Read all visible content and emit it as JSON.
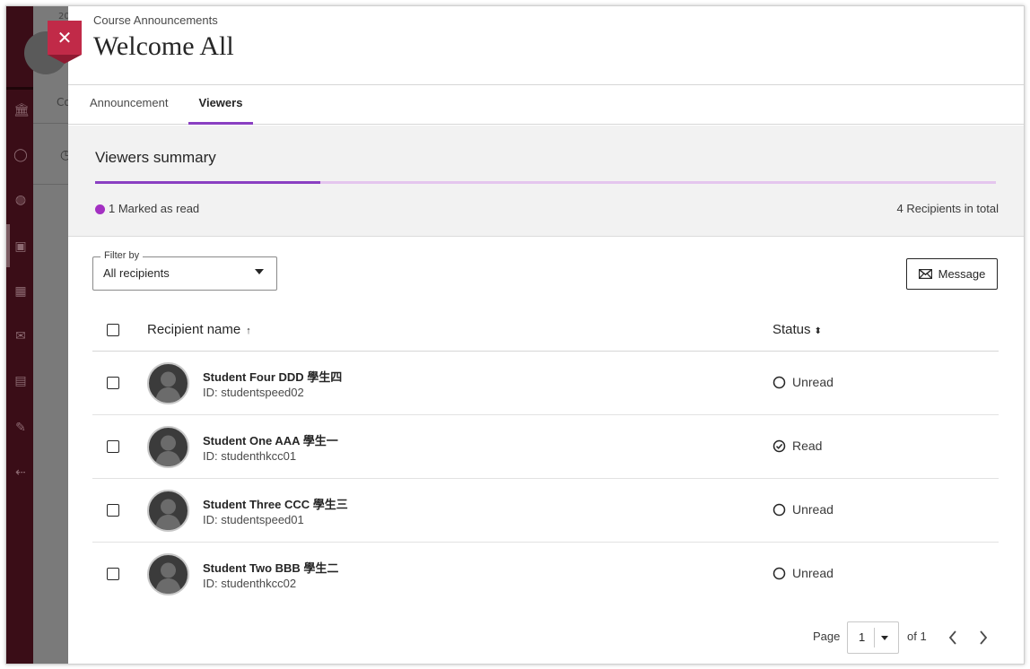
{
  "background": {
    "top_text": "20",
    "crumb_text": "Co"
  },
  "dialog": {
    "breadcrumb": "Course Announcements",
    "title": "Welcome All",
    "close_label": "✕"
  },
  "tabs": [
    {
      "label": "Announcement",
      "selected": false
    },
    {
      "label": "Viewers",
      "selected": true
    }
  ],
  "summary": {
    "title": "Viewers summary",
    "read_fraction": 0.25,
    "legend_label": "1 Marked as read",
    "total_label": "4 Recipients in total",
    "colors": {
      "read": "#8a3fc2",
      "unread": "#e4c6ee",
      "dot": "#a330c2"
    }
  },
  "filter": {
    "legend": "Filter by",
    "value": "All recipients"
  },
  "message_button": {
    "label": "Message",
    "icon": "envelope-icon"
  },
  "table": {
    "headers": {
      "name": "Recipient name",
      "name_sort_icon": "↑",
      "status": "Status",
      "status_sort_icon": "⬍"
    },
    "rows": [
      {
        "name": "Student Four DDD 學生四",
        "id": "ID: studentspeed02",
        "status": "Unread",
        "status_icon": "circle-empty-icon"
      },
      {
        "name": "Student One AAA 學生一",
        "id": "ID: studenthkcc01",
        "status": "Read",
        "status_icon": "circle-check-icon"
      },
      {
        "name": "Student Three CCC 學生三",
        "id": "ID: studentspeed01",
        "status": "Unread",
        "status_icon": "circle-empty-icon"
      },
      {
        "name": "Student Two BBB 學生二",
        "id": "ID: studenthkcc02",
        "status": "Unread",
        "status_icon": "circle-empty-icon"
      }
    ]
  },
  "pagination": {
    "page_label": "Page",
    "current_page": "1",
    "of_label": "of 1"
  }
}
